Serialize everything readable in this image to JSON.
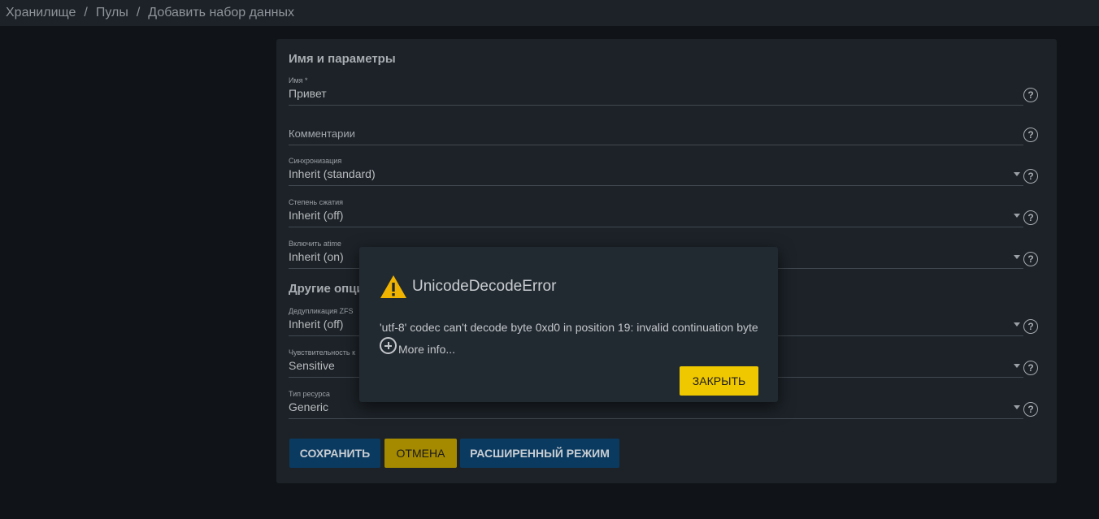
{
  "breadcrumb": {
    "items": [
      "Хранилище",
      "Пулы",
      "Добавить набор данных"
    ],
    "separator": "/"
  },
  "form": {
    "section1_title": "Имя и параметры",
    "section2_title": "Другие опци",
    "name": {
      "label": "Имя *",
      "value": "Привет"
    },
    "comments": {
      "placeholder": "Комментарии"
    },
    "sync": {
      "label": "Синхронизация",
      "value": "Inherit (standard)"
    },
    "compression": {
      "label": "Степень сжатия",
      "value": "Inherit (off)"
    },
    "atime": {
      "label": "Включить atime",
      "value": "Inherit (on)"
    },
    "dedup": {
      "label": "Дедупликация ZFS",
      "value": "Inherit (off)"
    },
    "case": {
      "label": "Чувствительность к",
      "value": "Sensitive"
    },
    "share_type": {
      "label": "Тип ресурса",
      "value": "Generic"
    },
    "help_glyph": "?"
  },
  "buttons": {
    "save": "СОХРАНИТЬ",
    "cancel": "ОТМЕНА",
    "advanced": "РАСШИРЕННЫЙ РЕЖИМ"
  },
  "dialog": {
    "title": "UnicodeDecodeError",
    "message": "'utf-8' codec can't decode byte 0xd0 in position 19: invalid continuation byte",
    "more_info": "More info...",
    "close": "ЗАКРЫТЬ",
    "icon": "warning-icon"
  },
  "colors": {
    "background": "#101419",
    "card": "#1c2228",
    "primary_button": "#0b3a60",
    "accent_yellow": "#f0c800",
    "warning": "#f0b400"
  }
}
